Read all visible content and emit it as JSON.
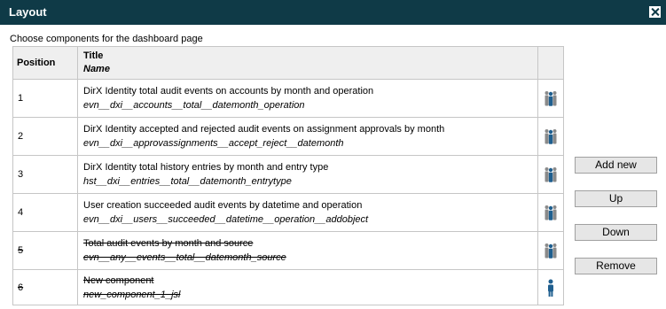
{
  "window": {
    "title": "Layout"
  },
  "instruction": "Choose components for the dashboard page",
  "table": {
    "headers": {
      "position": "Position",
      "title": "Title",
      "name": "Name"
    },
    "rows": [
      {
        "position": "1",
        "title": "DirX Identity total audit events on accounts by month and operation",
        "name": "evn__dxi__accounts__total__datemonth_operation",
        "struck": false,
        "icon": "people-group-icon"
      },
      {
        "position": "2",
        "title": "DirX Identity accepted and rejected audit events on assignment approvals by month",
        "name": "evn__dxi__approvassignments__accept_reject__datemonth",
        "struck": false,
        "icon": "people-group-icon"
      },
      {
        "position": "3",
        "title": "DirX Identity total history entries by month and entry type",
        "name": "hst__dxi__entries__total__datemonth_entrytype",
        "struck": false,
        "icon": "people-group-icon"
      },
      {
        "position": "4",
        "title": "User creation succeeded audit events by datetime and operation",
        "name": "evn__dxi__users__succeeded__datetime__operation__addobject",
        "struck": false,
        "icon": "people-group-icon"
      },
      {
        "position": "5",
        "title": "Total audit events by month and source",
        "name": "evn__any__events__total__datemonth_source",
        "struck": true,
        "icon": "people-group-icon"
      },
      {
        "position": "6",
        "title": "New component",
        "name": "new_component_1_jsl",
        "struck": true,
        "icon": "person-icon"
      }
    ]
  },
  "buttons": {
    "add_new": "Add new",
    "up": "Up",
    "down": "Down",
    "remove": "Remove"
  },
  "colors": {
    "titlebar": "#0f3a47",
    "icon_gray": "#8a8a8a",
    "icon_blue": "#1f5f8f"
  }
}
